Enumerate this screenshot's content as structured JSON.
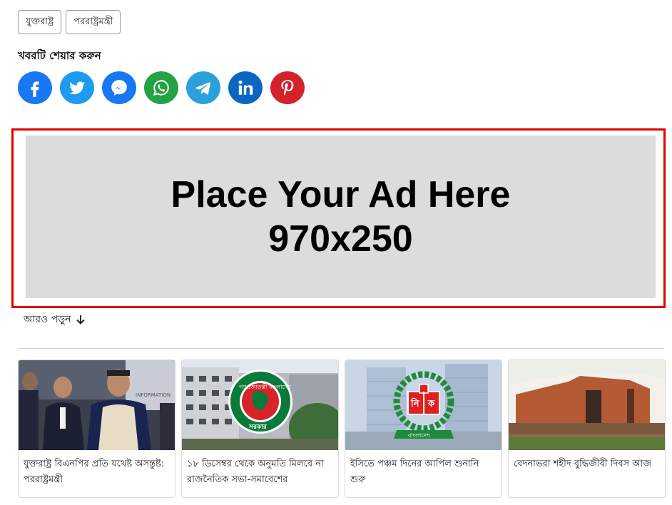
{
  "tags": [
    "যুক্তরাষ্ট্র",
    "পররাষ্ট্রমন্ত্রী"
  ],
  "share": {
    "title": "খবরটি শেয়ার করুন",
    "buttons": [
      {
        "name": "facebook",
        "color": "#1877f2"
      },
      {
        "name": "twitter",
        "color": "#1d9bf0"
      },
      {
        "name": "messenger",
        "color": "#1877f2"
      },
      {
        "name": "whatsapp",
        "color": "#25a244"
      },
      {
        "name": "telegram",
        "color": "#2aa1da"
      },
      {
        "name": "linkedin",
        "color": "#0a66c2"
      },
      {
        "name": "pinterest",
        "color": "#d3222a"
      }
    ]
  },
  "ad": {
    "line1": "Place Your Ad Here",
    "line2": "970x250"
  },
  "read_more": {
    "label": "আরও পড়ুন",
    "icon": "arrow-down-icon"
  },
  "articles": [
    {
      "title": "যুক্তরাষ্ট্র বিএনপির প্রতি যথেষ্ট অসন্তুষ্ট: পররাষ্ট্রমন্ত্রী",
      "image": "minister-photo"
    },
    {
      "title": "১৮ ডিসেম্বর থেকে অনুমতি মিলবে না রাজনৈতিক সভা-সমাবেশের",
      "image": "government-seal-photo"
    },
    {
      "title": "ইসিতে পঞ্চম দিনের আপিল শুনানি শুরু",
      "image": "election-commission-logo-photo"
    },
    {
      "title": "বেদনাভরা শহীদ বুদ্ধিজীবী দিবস আজ",
      "image": "memorial-photo"
    }
  ],
  "inner_text": {
    "information": "INFORMATION",
    "seal_ring": "গণপ্রজাতন্ত্রী বাংলাদেশ",
    "seal_bottom": "সরকার",
    "ec_left": "নি",
    "ec_right": "ক",
    "ec_ribbon": "বাংলাদেশ"
  },
  "colors": {
    "ad_border": "#e10000",
    "ad_bg": "#dcdcdc"
  }
}
